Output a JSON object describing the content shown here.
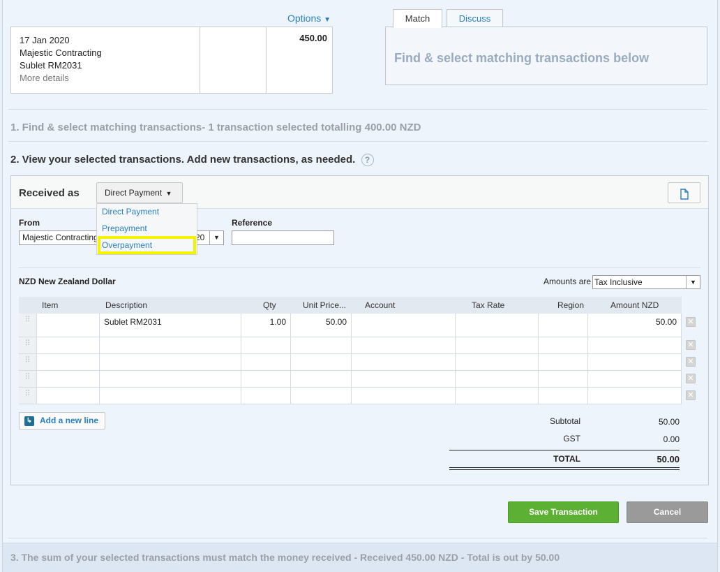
{
  "statement": {
    "options_label": "Options",
    "date": "17 Jan 2020",
    "payee": "Majestic Contracting",
    "reference": "Sublet RM2031",
    "more_details": "More details",
    "amount": "450.00"
  },
  "tabs": {
    "match": "Match",
    "discuss": "Discuss"
  },
  "match_message": "Find & select matching transactions below",
  "steps": {
    "step1": "1. Find & select matching transactions- 1 transaction selected totalling 400.00 NZD",
    "step2": "2. View your selected transactions. Add new transactions, as needed.",
    "step3": "3. The sum of your selected transactions must match the money received - Received 450.00 NZD - Total is out by 50.00"
  },
  "received_as": {
    "label": "Received as",
    "selected": "Direct Payment",
    "options": [
      "Direct Payment",
      "Prepayment",
      "Overpayment"
    ]
  },
  "form": {
    "from_label": "From",
    "from_value": "Majestic Contracting",
    "from_tail": "20",
    "reference_label": "Reference",
    "reference_value": ""
  },
  "currency_label": "NZD New Zealand Dollar",
  "amounts_are": {
    "label": "Amounts are",
    "value": "Tax Inclusive"
  },
  "table": {
    "headers": [
      "Item",
      "Description",
      "Qty",
      "Unit Price...",
      "Account",
      "Tax Rate",
      "Region",
      "Amount NZD"
    ],
    "rows": [
      {
        "item": "",
        "description": "Sublet RM2031",
        "qty": "1.00",
        "unit_price": "50.00",
        "account": "",
        "tax_rate": "",
        "region": "",
        "amount": "50.00"
      },
      {
        "item": "",
        "description": "",
        "qty": "",
        "unit_price": "",
        "account": "",
        "tax_rate": "",
        "region": "",
        "amount": ""
      },
      {
        "item": "",
        "description": "",
        "qty": "",
        "unit_price": "",
        "account": "",
        "tax_rate": "",
        "region": "",
        "amount": ""
      },
      {
        "item": "",
        "description": "",
        "qty": "",
        "unit_price": "",
        "account": "",
        "tax_rate": "",
        "region": "",
        "amount": ""
      },
      {
        "item": "",
        "description": "",
        "qty": "",
        "unit_price": "",
        "account": "",
        "tax_rate": "",
        "region": "",
        "amount": ""
      }
    ]
  },
  "add_line_label": "Add a new line",
  "totals": {
    "subtotal_label": "Subtotal",
    "subtotal": "50.00",
    "gst_label": "GST",
    "gst": "0.00",
    "total_label": "TOTAL",
    "total": "50.00"
  },
  "buttons": {
    "save": "Save Transaction",
    "cancel": "Cancel"
  },
  "colors": {
    "accent": "#2a80c0",
    "save": "#5cb135",
    "highlight": "#f4f400"
  }
}
